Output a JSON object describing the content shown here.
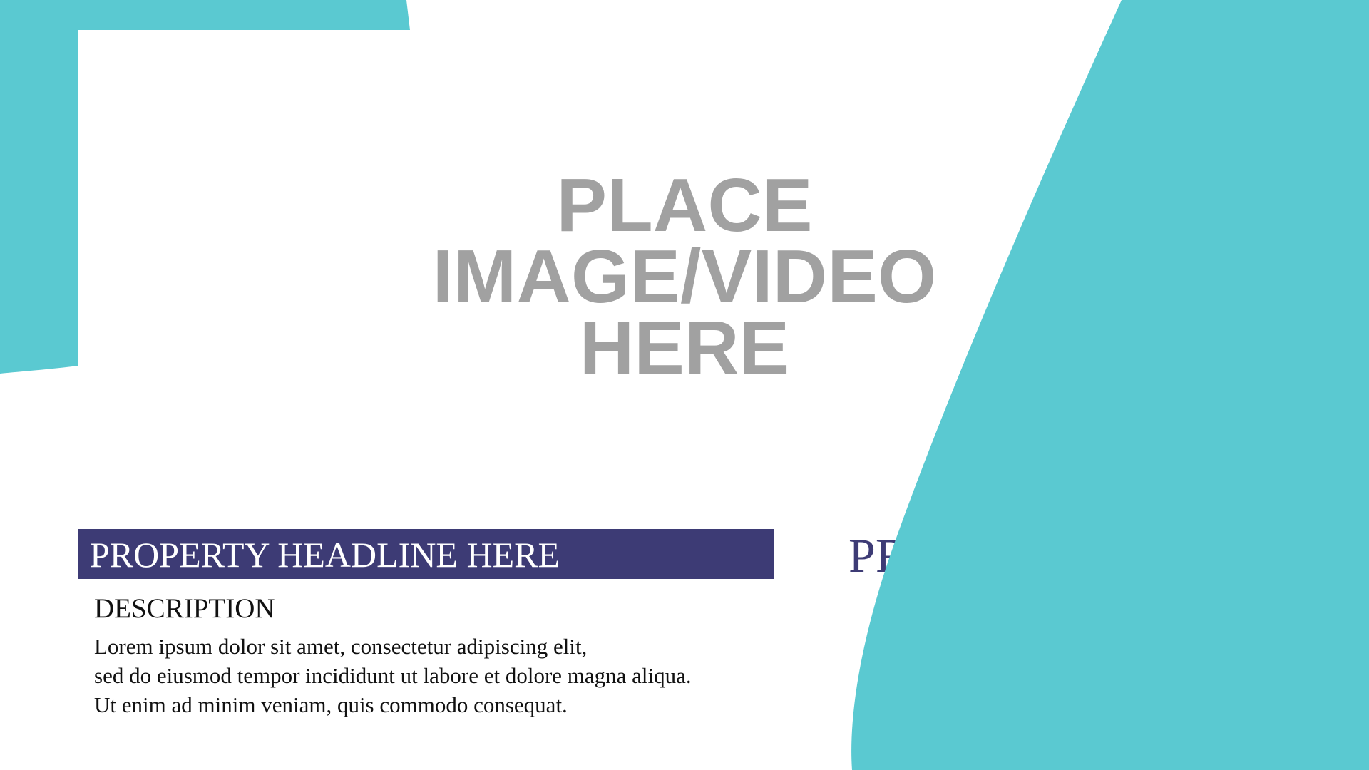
{
  "colors": {
    "accent_teal": "#5ac9d1",
    "headline_bar": "#3d3b75",
    "placeholder_text": "#a1a1a1",
    "background": "#ffffff"
  },
  "placeholder": {
    "lines": [
      "PLACE",
      "IMAGE/VIDEO",
      "HERE"
    ]
  },
  "headline": {
    "text": "PROPERTY HEADLINE HERE"
  },
  "description": {
    "title": "DESCRIPTION",
    "lines": [
      "Lorem ipsum dolor sit amet, consectetur adipiscing elit,",
      "sed do eiusmod tempor incididunt ut labore et dolore magna aliqua.",
      "Ut enim ad minim veniam, quis commodo consequat."
    ]
  },
  "price": {
    "text": "PR"
  }
}
